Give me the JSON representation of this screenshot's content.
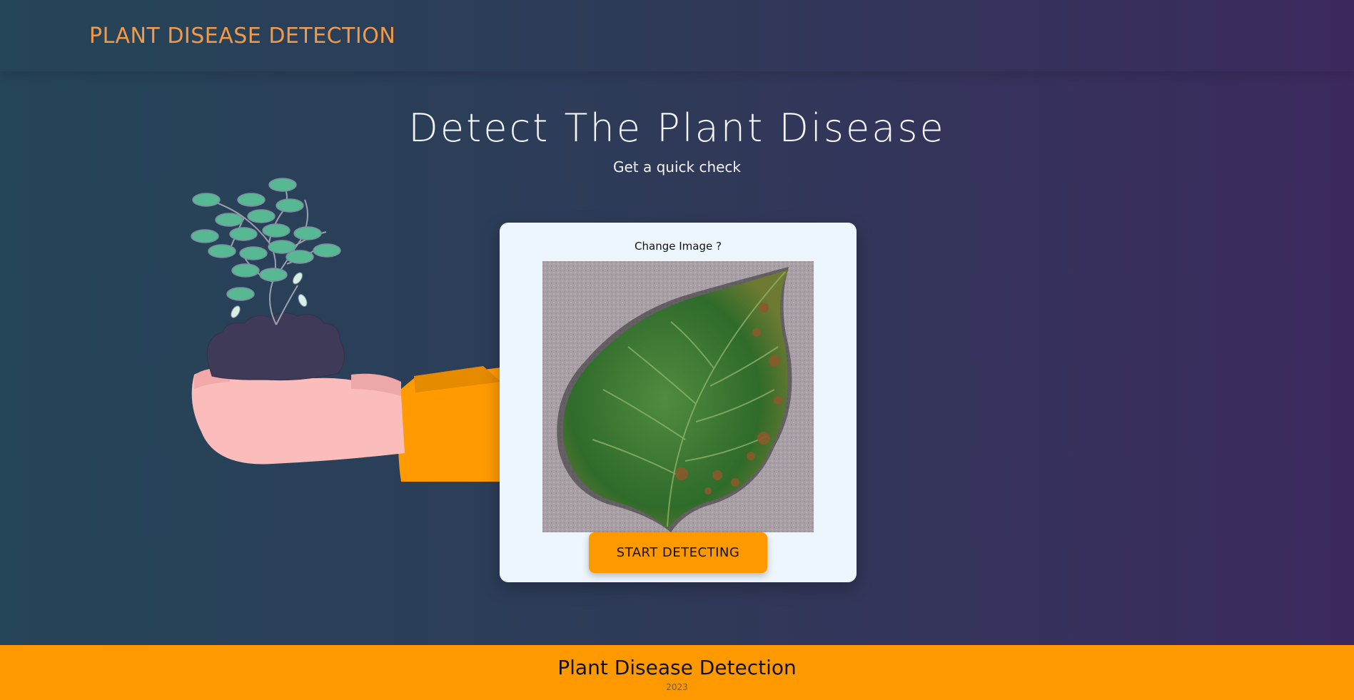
{
  "navbar": {
    "brand": "PLANT DISEASE DETECTION"
  },
  "hero": {
    "title": "Detect The Plant Disease",
    "subtitle": "Get a quick check"
  },
  "upload_card": {
    "change_link": "Change Image ?",
    "start_button": "START DETECTING"
  },
  "footer": {
    "title": "Plant Disease Detection",
    "year": "2023"
  },
  "colors": {
    "accent": "#ff9900",
    "brand_text": "#f2994a",
    "card_bg": "#eef6fd",
    "bg_left": "#254558",
    "bg_right": "#3c2a5e"
  },
  "icons": {
    "illustration": "hand-holding-plant-illustration",
    "preview": "diseased-leaf-image"
  }
}
